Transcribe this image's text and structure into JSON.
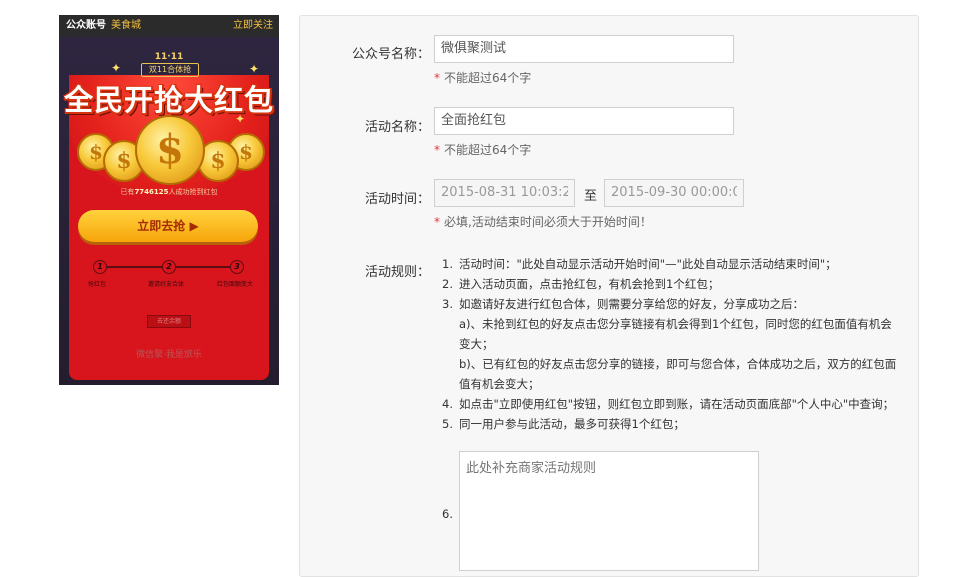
{
  "preview": {
    "account_label": "公众账号",
    "account_name": "美食城",
    "follow_label": "立即关注",
    "promo_tag": "11·11",
    "promo_sub": "双11合体抢",
    "promo_title": "全民开抢大红包",
    "count_prefix": "已有",
    "count_value": "7746125",
    "count_suffix": "人成功抢到红包",
    "grab_button": "立即去抢 ▶",
    "steps": [
      {
        "num": "1",
        "label": "抢红包"
      },
      {
        "num": "2",
        "label": "邀请好友合体"
      },
      {
        "num": "3",
        "label": "红包面额变大"
      }
    ],
    "mini_button": "去还余额",
    "brand": "微信聚·我是旅乐"
  },
  "form": {
    "account_label": "公众号名称：",
    "account_value": "微俱聚测试",
    "account_hint": "不能超过64个字",
    "activity_label": "活动名称：",
    "activity_value": "全面抢红包",
    "activity_hint": "不能超过64个字",
    "time_label": "活动时间：",
    "start_time": "2015-08-31 10:03:2",
    "to_label": "至",
    "end_time": "2015-09-30 00:00:0",
    "time_hint": "必填,活动结束时间必须大于开始时间！",
    "rules_label": "活动规则：",
    "required_mark": "*",
    "rules": [
      {
        "num": "1.",
        "text": "活动时间：\"此处自动显示活动开始时间\"—\"此处自动显示活动结束时间\"；"
      },
      {
        "num": "2.",
        "text": "进入活动页面，点击抢红包，有机会抢到1个红包；"
      },
      {
        "num": "3.",
        "text": "如邀请好友进行红包合体，则需要分享给您的好友，分享成功之后："
      }
    ],
    "rule3_a": "a)、未抢到红包的好友点击您分享链接有机会得到1个红包，同时您的红包面值有机会变大；",
    "rule3_b": "b)、已有红包的好友点击您分享的链接，即可与您合体，合体成功之后，双方的红包面值有机会变大；",
    "rule4_num": "4.",
    "rule4_text": "如点击\"立即使用红包\"按钮，则红包立即到账，请在活动页面底部\"个人中心\"中查询；",
    "rule5_num": "5.",
    "rule5_text": "同一用户参与此活动，最多可获得1个红包；",
    "rule6_num": "6.",
    "rule6_placeholder": "此处补充商家活动规则"
  }
}
